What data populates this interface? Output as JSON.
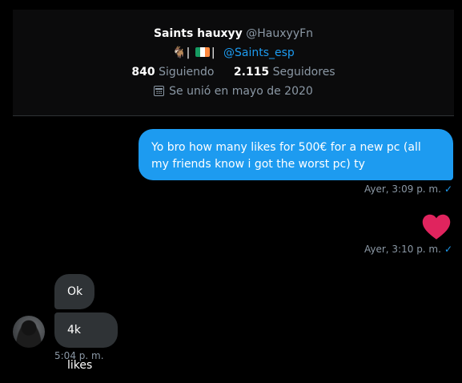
{
  "profile": {
    "name": "Saints hauxyy",
    "handle": "@HauxyyFn",
    "bio_separator_1": "|",
    "bio_separator_2": "|",
    "bio_link": "@Saints_esp",
    "following_count": "840",
    "following_label": "Siguiendo",
    "followers_count": "2.115",
    "followers_label": "Seguidores",
    "joined": "Se unió en mayo de 2020",
    "emoji_icons": [
      "goat-icon",
      "ireland-flag-icon"
    ]
  },
  "messages": {
    "outgoing_text": "Yo bro how many likes for 500€ for a new pc (all my friends know i got the worst pc) ty",
    "outgoing_time": "Ayer, 3:09 p. m.",
    "heart_time": "Ayer, 3:10 p. m.",
    "check_mark": "✓",
    "reply_1": "Ok",
    "reply_2": "4k likes",
    "reply_time": "5:04 p. m."
  },
  "colors": {
    "accent": "#1d9bf0",
    "incoming_bubble": "#2f3336",
    "heart": "#f91880"
  }
}
